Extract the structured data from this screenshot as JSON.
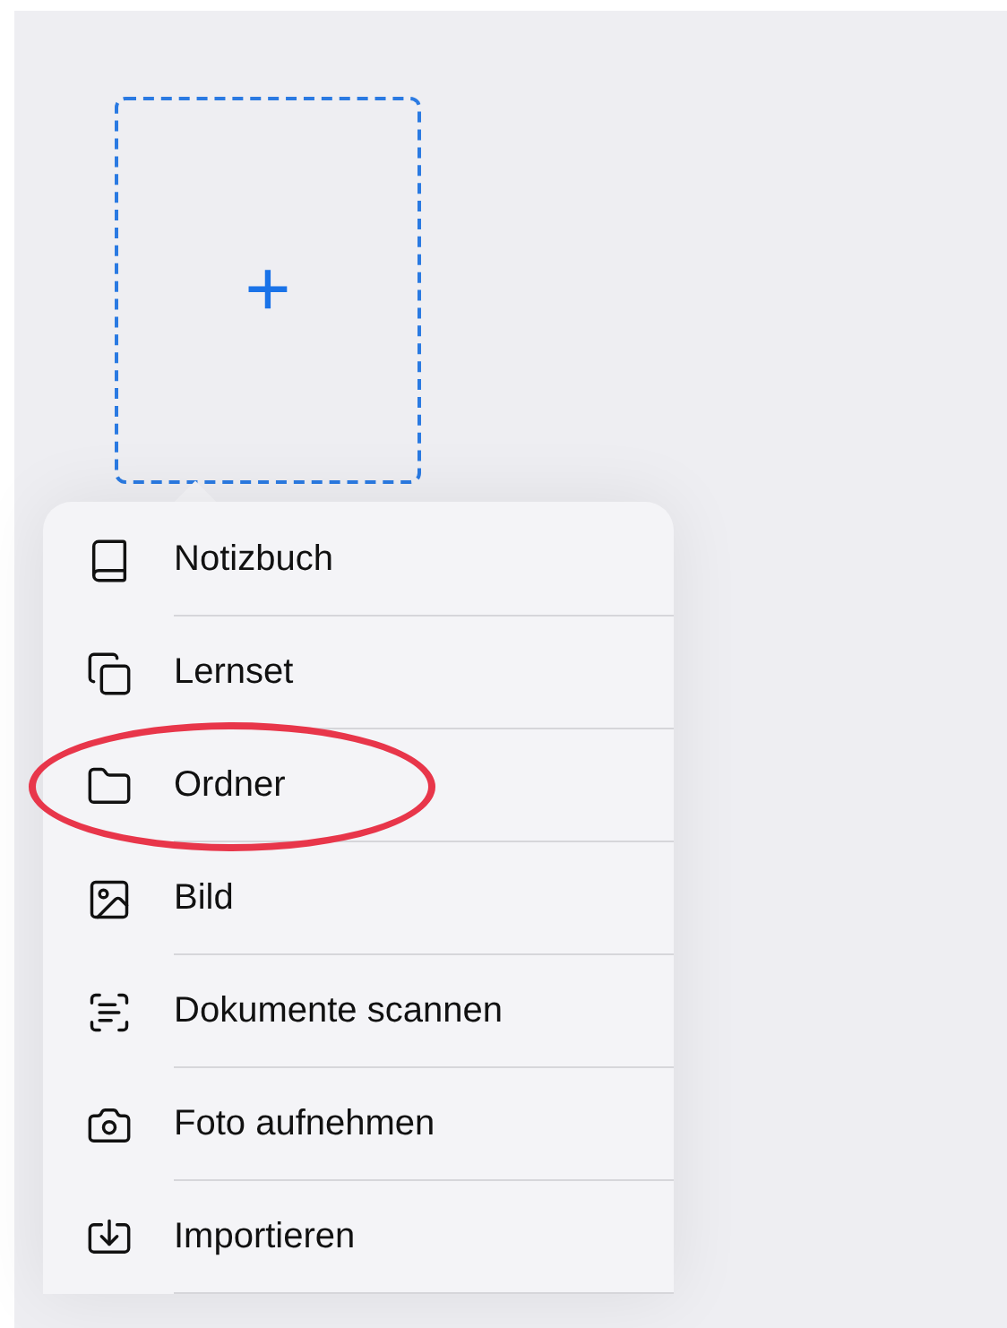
{
  "add_tile": {
    "symbol": "+"
  },
  "menu": {
    "items": [
      {
        "label": "Notizbuch",
        "kind": "notebook",
        "circled": false
      },
      {
        "label": "Lernset",
        "kind": "cards",
        "circled": false
      },
      {
        "label": "Ordner",
        "kind": "folder",
        "circled": true
      },
      {
        "label": "Bild",
        "kind": "image",
        "circled": false
      },
      {
        "label": "Dokumente scannen",
        "kind": "scan",
        "circled": false
      },
      {
        "label": "Foto aufnehmen",
        "kind": "camera",
        "circled": false
      },
      {
        "label": "Importieren",
        "kind": "import",
        "circled": false
      }
    ]
  }
}
